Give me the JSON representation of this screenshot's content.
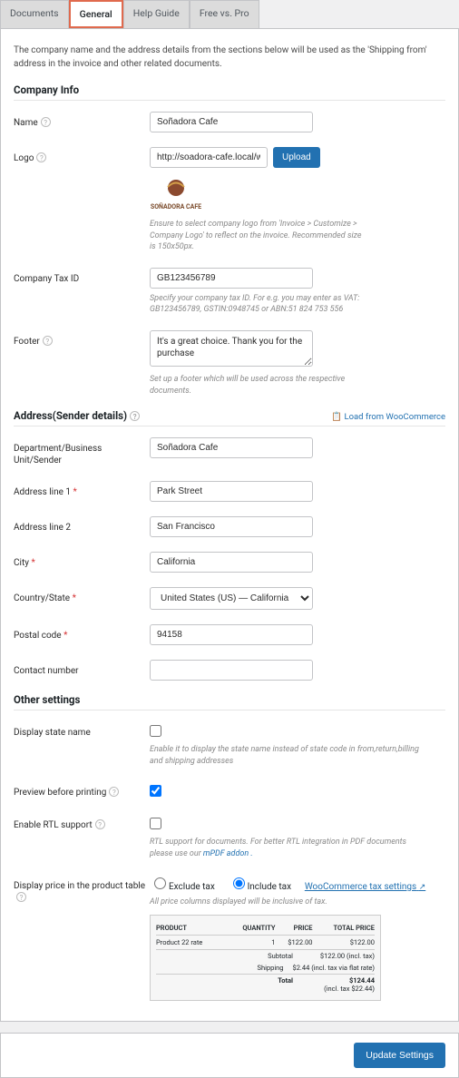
{
  "tabs": {
    "documents": "Documents",
    "general": "General",
    "help": "Help Guide",
    "free_pro": "Free vs. Pro"
  },
  "intro": "The company name and the address details from the sections below will be used as the 'Shipping from' address in the invoice and other related documents.",
  "company_info": {
    "heading": "Company Info",
    "name_lbl": "Name",
    "name_val": "Soñadora Cafe",
    "logo_lbl": "Logo",
    "logo_val": "http://soadora-cafe.local/wp",
    "upload_btn": "Upload",
    "logo_desc": "Ensure to select company logo from 'Invoice > Customize > Company Logo' to reflect on the invoice. Recommended size is 150x50px.",
    "tax_lbl": "Company Tax ID",
    "tax_val": "GB123456789",
    "tax_desc": "Specify your company tax ID. For e.g. you may enter as VAT: GB123456789, GSTIN:0948745 or ABN:51 824 753 556",
    "footer_lbl": "Footer",
    "footer_val": "It's a great choice. Thank you for the purchase",
    "footer_desc": "Set up a footer which will be used across the respective documents."
  },
  "address": {
    "heading": "Address(Sender details)",
    "load_link": "Load from WooCommerce",
    "dept_lbl": "Department/Business Unit/Sender",
    "dept_val": "Soñadora Cafe",
    "line1_lbl": "Address line 1",
    "line1_val": "Park Street",
    "line2_lbl": "Address line 2",
    "line2_val": "San Francisco",
    "city_lbl": "City",
    "city_val": "California",
    "country_lbl": "Country/State",
    "country_val": "United States (US) — California",
    "postal_lbl": "Postal code",
    "postal_val": "94158",
    "contact_lbl": "Contact number",
    "contact_val": ""
  },
  "other": {
    "heading": "Other settings",
    "state_lbl": "Display state name",
    "state_desc": "Enable it to display the state name instead of state code in from,return,billing and shipping addresses",
    "preview_lbl": "Preview before printing",
    "rtl_lbl": "Enable RTL support",
    "rtl_desc_pre": "RTL support for documents. For better RTL integration in PDF documents please use our ",
    "rtl_link": "mPDF addon .",
    "price_lbl": "Display price in the product table",
    "exclude": "Exclude tax",
    "include": "Include tax",
    "tax_settings": "WooCommerce tax settings",
    "price_desc": "All price columns displayed will be inclusive of tax.",
    "table": {
      "h_product": "PRODUCT",
      "h_qty": "QUANTITY",
      "h_price": "PRICE",
      "h_total": "TOTAL PRICE",
      "row_product": "Product 22 rate",
      "row_qty": "1",
      "row_price": "$122.00",
      "row_total": "$122.00",
      "subtotal_k": "Subtotal",
      "subtotal_v": "$122.00 (incl. tax)",
      "shipping_k": "Shipping",
      "shipping_v": "$2.44 (incl. tax via flat rate)",
      "total_k": "Total",
      "total_v": "$124.44",
      "total_sub": "(incl. tax $22.44)"
    }
  },
  "update_btn": "Update Settings"
}
